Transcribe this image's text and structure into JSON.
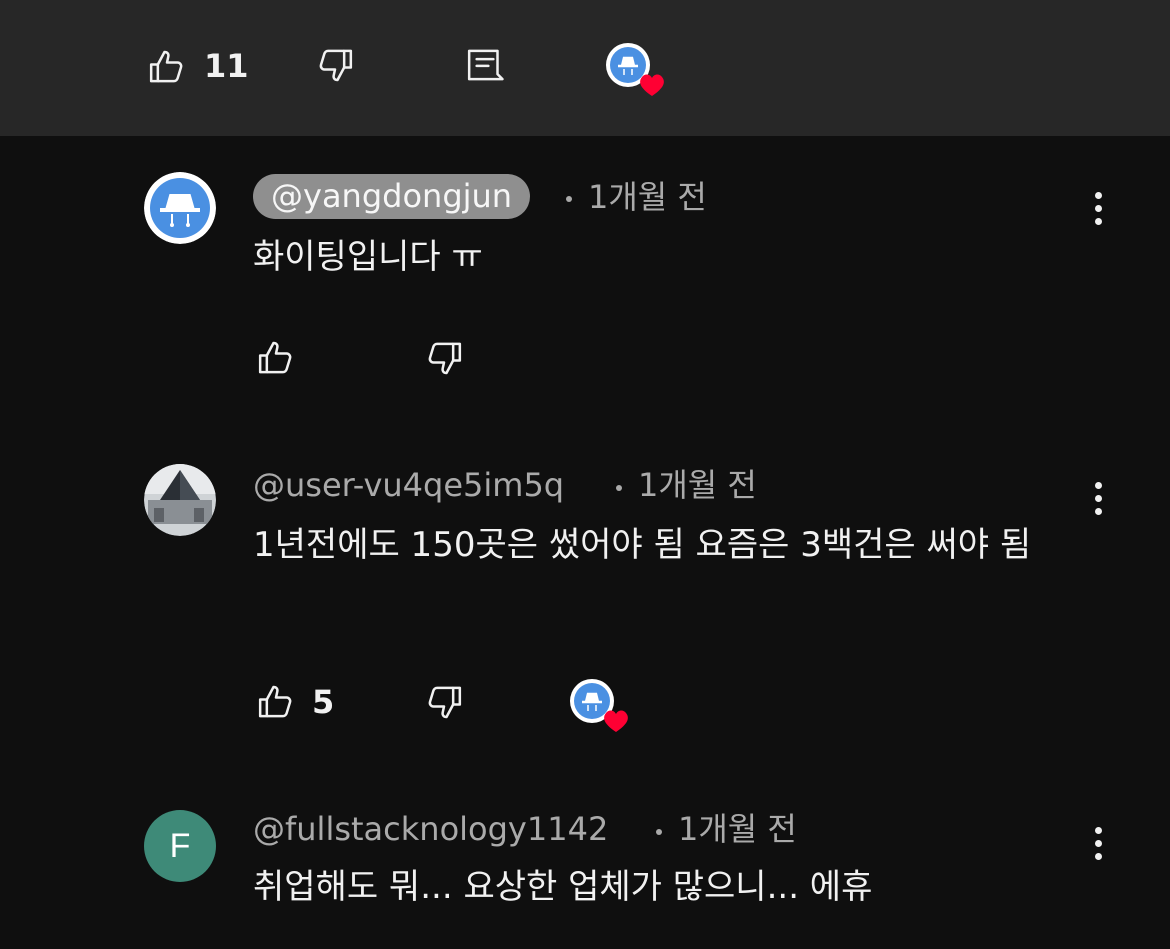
{
  "video_actions": {
    "like_count": "11"
  },
  "comments": [
    {
      "handle": "@yangdongjun",
      "time": "1개월 전",
      "text": "화이팅입니다 ㅠ",
      "like_count": ""
    },
    {
      "handle": "@user-vu4qe5im5q",
      "time": "1개월 전",
      "text": "1년전에도 150곳은 썼어야 됨 요즘은 3백건은 써야 됨",
      "like_count": "5"
    },
    {
      "handle": "@fullstacknology1142",
      "time": "1개월 전",
      "text": "취업해도 뭐... 요상한 업체가 많으니... 에휴",
      "avatar_letter": "F"
    }
  ],
  "colors": {
    "background": "#0f0f0f",
    "top_bar": "#272727",
    "muted_text": "#aaaaaa",
    "creator_avatar_blue": "#4a90e2",
    "heart_red": "#ff0033",
    "letter_avatar_bg": "#3e8a78"
  },
  "icons": {
    "like": "thumbs-up-icon",
    "dislike": "thumbs-down-icon",
    "reply": "comment-icon",
    "creator_heart": "creator-heart-badge",
    "more": "more-vertical-icon"
  }
}
